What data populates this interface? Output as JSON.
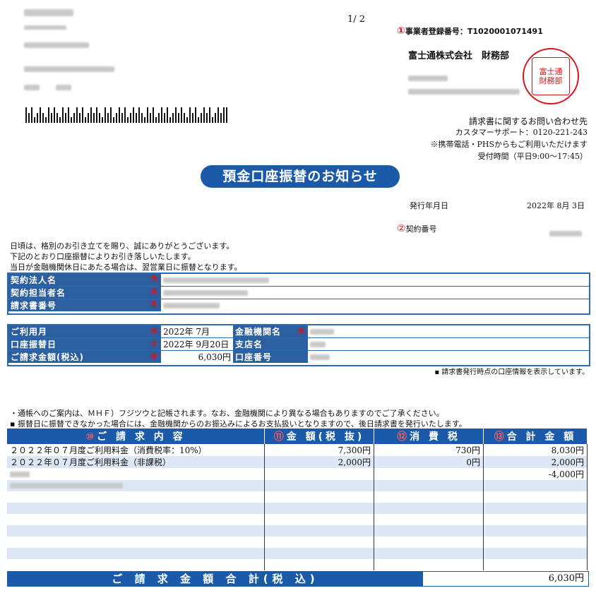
{
  "header": {
    "page_number": "1/ 2",
    "registration_marker": "①",
    "registration_number": "事業者登録番号：T1020001071491",
    "company": "富士通株式会社　財務部",
    "stamp_text": "富士通株式会社財務部印"
  },
  "contact": {
    "title": "請求書に関するお問い合わせ先",
    "line1": "カスタマーサポート：0120-221-243",
    "line2": "※携帯電話・PHSからもご利用いただけます",
    "line3": "受付時間（平日9:00〜17:45）"
  },
  "banner": "預金口座振替のお知らせ",
  "issue": {
    "label": "発行年月日",
    "date": "2022年 8月 3日"
  },
  "contract": {
    "marker": "②",
    "label": "契約番号"
  },
  "intro": {
    "line1": "日頃は、格別のお引き立てを賜り、誠にありがとうございます。",
    "line2": "下記のとおり口座振替によりお引き落しいたします。",
    "line3": "当日が金融機関休日にあたる場合は、翌営業日に振替となります。"
  },
  "box1": [
    {
      "label": "契約法人名",
      "marker": "③"
    },
    {
      "label": "契約担当者名",
      "marker": "④"
    },
    {
      "label": "請求書番号",
      "marker": "⑤"
    }
  ],
  "box2": {
    "usage_month": {
      "label": "ご利用月",
      "marker": "⑥",
      "value": "2022年 7月"
    },
    "transfer_date": {
      "label": "口座振替日",
      "marker": "⑦",
      "value": "2022年 9月20日"
    },
    "amount": {
      "label": "ご請求金額(税込)",
      "marker": "⑧",
      "value": "6,030円"
    },
    "bank": {
      "label": "金融機関名",
      "marker": "⑨"
    },
    "branch": {
      "label": "支店名"
    },
    "account": {
      "label": "口座番号"
    }
  },
  "box2_note": "▪ 請求書発行時点の口座情報を表示しています。",
  "notes": {
    "line1": "・通帳へのご案内は、ＭＨＦ）フジツウと記帳されます。なお、金融機関により異なる場合もありますのでご了承ください。",
    "line2": "▪ 振替日に振替できなかった場合には、金融機関からのお振込みによるお支払扱いとなりますので、後日請求書を発行いたします。"
  },
  "table": {
    "headers": [
      {
        "marker": "⑩",
        "label": "ご 請 求 内 容"
      },
      {
        "marker": "⑪",
        "label": "金 額(税 抜)"
      },
      {
        "marker": "⑫",
        "label": "消 費 税"
      },
      {
        "marker": "⑬",
        "label": "合 計 金 額"
      }
    ],
    "rows": [
      {
        "desc": "２０２２年０７月度ご利用料金（消費税率：10%）",
        "amount": "7,300円",
        "tax": "730円",
        "total": "8,030円"
      },
      {
        "desc": "２０２２年０７月度ご利用料金（非課税）",
        "amount": "2,000円",
        "tax": "0円",
        "total": "2,000円"
      },
      {
        "desc": "",
        "amount": "",
        "tax": "",
        "total": "-4,000円"
      }
    ],
    "total_label": "ご 請 求 金 額 合 計(税 込)",
    "total_value": "6,030円"
  }
}
